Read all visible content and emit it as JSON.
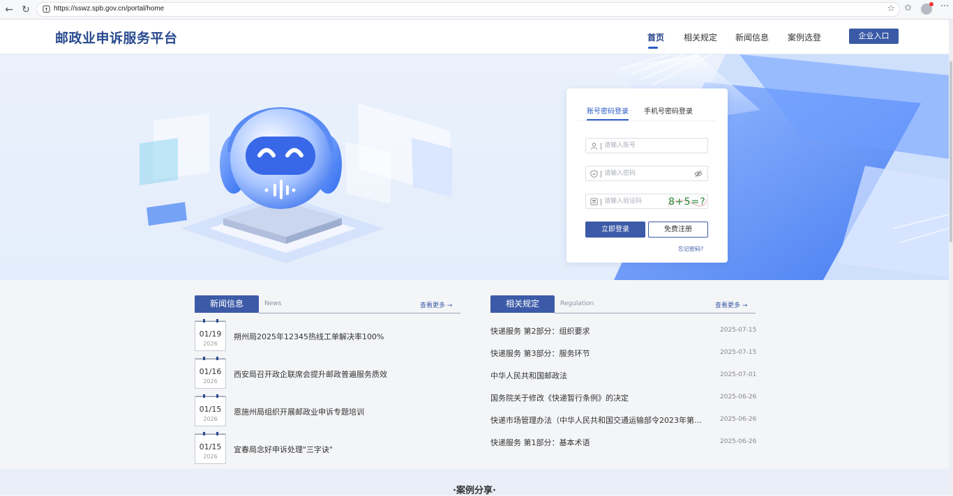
{
  "browser": {
    "url": "https://sswz.spb.gov.cn/portal/home"
  },
  "site": {
    "logo": "邮政业申诉服务平台",
    "nav": [
      "首页",
      "相关规定",
      "新闻信息",
      "案例选登"
    ],
    "enterprise_btn": "企业入口"
  },
  "login": {
    "tabs": [
      "账号密码登录",
      "手机号密码登录"
    ],
    "account_placeholder": "请输入账号",
    "password_placeholder": "请输入密码",
    "captcha_placeholder": "请输入验证码",
    "captcha_text": "8+5=?",
    "login_btn": "立即登录",
    "register_btn": "免费注册",
    "forgot": "忘记密码?"
  },
  "news": {
    "label": "新闻信息",
    "en": "News",
    "more": "查看更多 →",
    "items": [
      {
        "md": "01/19",
        "yr": "2026",
        "title": "朔州局2025年12345热线工单解决率100%"
      },
      {
        "md": "01/16",
        "yr": "2026",
        "title": "西安局召开政企联席会提升邮政普遍服务质效"
      },
      {
        "md": "01/15",
        "yr": "2026",
        "title": "恩施州局组织开展邮政业申诉专题培训"
      },
      {
        "md": "01/15",
        "yr": "2026",
        "title": "宜春局念好申诉处理\"三字诀\""
      }
    ]
  },
  "regulation": {
    "label": "相关规定",
    "en": "Regulation",
    "more": "查看更多 →",
    "items": [
      {
        "title": "快递服务 第2部分：组织要求",
        "date": "2025-07-15"
      },
      {
        "title": "快递服务 第3部分：服务环节",
        "date": "2025-07-15"
      },
      {
        "title": "中华人民共和国邮政法",
        "date": "2025-07-01"
      },
      {
        "title": "国务院关于修改《快递暂行条例》的决定",
        "date": "2025-06-26"
      },
      {
        "title": "快递市场管理办法（中华人民共和国交通运输部令2023年第...",
        "date": "2025-06-26"
      },
      {
        "title": "快递服务 第1部分：基本术语",
        "date": "2025-06-26"
      }
    ]
  },
  "case": {
    "title": "·案例分享·"
  },
  "colors": {
    "brand": "#3c5aa7",
    "logo": "#2a4a8f",
    "accent": "#2c5cc5"
  }
}
